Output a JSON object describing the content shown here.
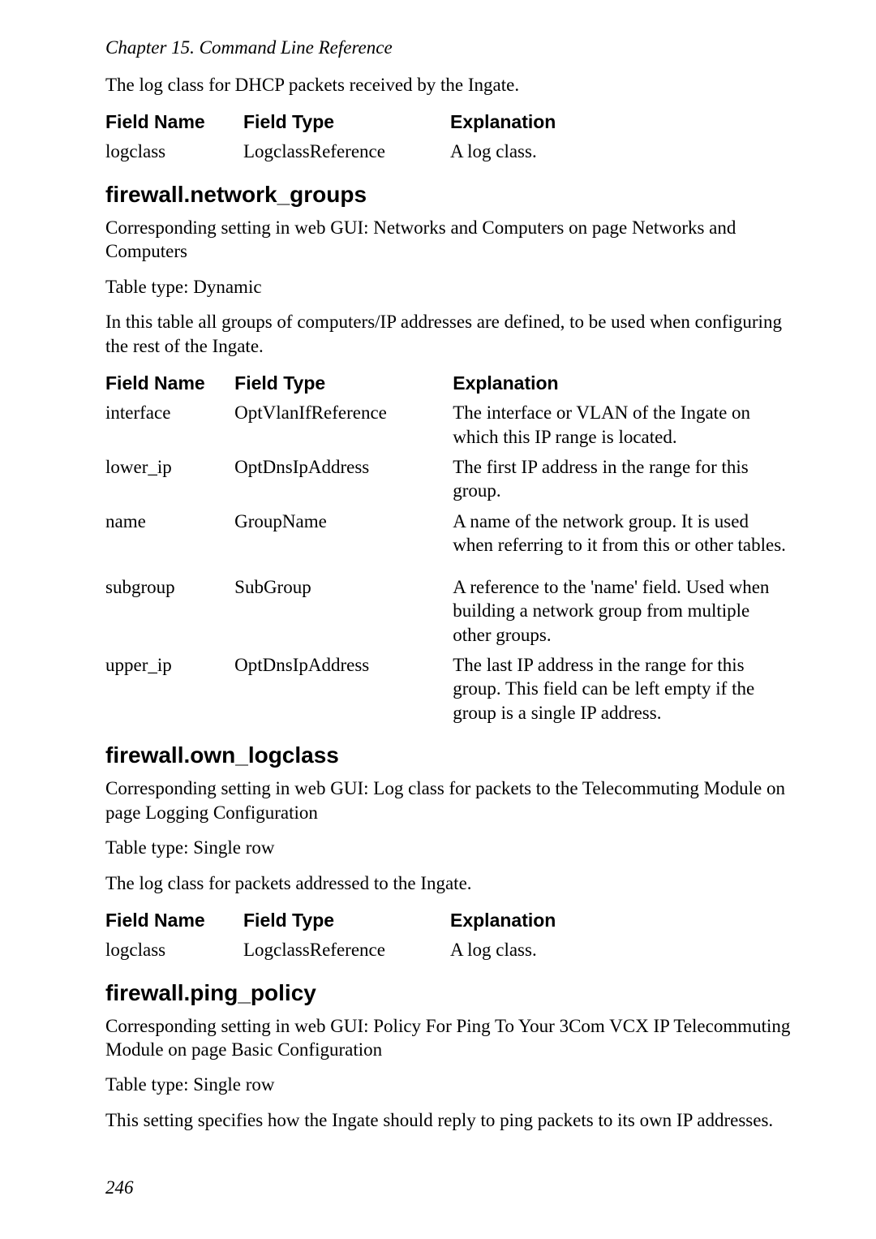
{
  "chapter_header": "Chapter 15. Command Line Reference",
  "intro_text": "The log class for DHCP packets received by the Ingate.",
  "columns": {
    "name": "Field Name",
    "type": "Field Type",
    "expl": "Explanation"
  },
  "table_intro": {
    "rows": [
      {
        "name": "logclass",
        "type": "LogclassReference",
        "expl": "A log class."
      }
    ]
  },
  "section1": {
    "heading": "firewall.network_groups",
    "p1": "Corresponding setting in web GUI: Networks and Computers on page Networks and Computers",
    "p2": "Table type: Dynamic",
    "p3": "In this table all groups of computers/IP addresses are defined, to be used when configuring the rest of the Ingate.",
    "rows": [
      {
        "name": "interface",
        "type": "OptVlanIfReference",
        "expl": "The interface or VLAN of the Ingate on which this IP range is located."
      },
      {
        "name": "lower_ip",
        "type": "OptDnsIpAddress",
        "expl": "The first IP address in the range for this group."
      },
      {
        "name": "name",
        "type": "GroupName",
        "expl": "A name of the network group. It is used when referring to it from this or other tables."
      },
      {
        "name": "subgroup",
        "type": "SubGroup",
        "expl": "A reference to the 'name' field. Used when building a network group from multiple other groups."
      },
      {
        "name": "upper_ip",
        "type": "OptDnsIpAddress",
        "expl": "The last IP address in the range for this group. This field can be left empty if the group is a single IP address."
      }
    ]
  },
  "section2": {
    "heading": "firewall.own_logclass",
    "p1": "Corresponding setting in web GUI: Log class for packets to the Telecommuting Module on page Logging Configuration",
    "p2": "Table type: Single row",
    "p3": "The log class for packets addressed to the Ingate.",
    "rows": [
      {
        "name": "logclass",
        "type": "LogclassReference",
        "expl": "A log class."
      }
    ]
  },
  "section3": {
    "heading": "firewall.ping_policy",
    "p1": "Corresponding setting in web GUI: Policy For Ping To Your 3Com VCX IP Telecommuting Module on page Basic Configuration",
    "p2": "Table type: Single row",
    "p3": "This setting specifies how the Ingate should reply to ping packets to its own IP addresses."
  },
  "page_number": "246"
}
